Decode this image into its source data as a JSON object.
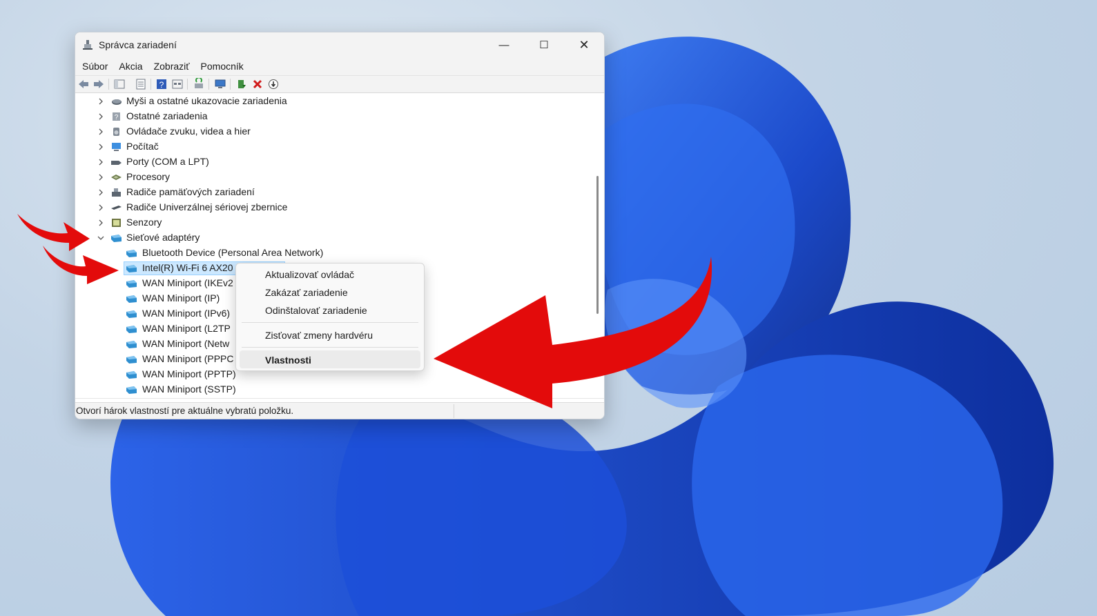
{
  "window": {
    "title": "Správca zariadení",
    "controls": {
      "minimize": "—",
      "maximize": "☐",
      "close": "✕"
    }
  },
  "menu": [
    "Súbor",
    "Akcia",
    "Zobraziť",
    "Pomocník"
  ],
  "toolbar_icons": [
    "back-icon",
    "forward-icon",
    "show-hide-tree-icon",
    "properties-icon",
    "help-icon",
    "view-icon",
    "scan-hardware-icon",
    "monitor-icon",
    "update-driver-icon",
    "uninstall-icon",
    "disable-icon"
  ],
  "tree": {
    "categories": [
      {
        "label": "Myši a ostatné ukazovacie zariadenia",
        "icon": "mouse-icon",
        "expanded": false
      },
      {
        "label": "Ostatné zariadenia",
        "icon": "unknown-device-icon",
        "expanded": false
      },
      {
        "label": "Ovládače zvuku, videa a hier",
        "icon": "speaker-icon",
        "expanded": false
      },
      {
        "label": "Počítač",
        "icon": "computer-icon",
        "expanded": false
      },
      {
        "label": "Porty (COM a LPT)",
        "icon": "port-icon",
        "expanded": false
      },
      {
        "label": "Procesory",
        "icon": "processor-icon",
        "expanded": false
      },
      {
        "label": "Radiče pamäťových zariadení",
        "icon": "storage-controller-icon",
        "expanded": false
      },
      {
        "label": "Radiče Univerzálnej sériovej zbernice",
        "icon": "usb-icon",
        "expanded": false
      },
      {
        "label": "Senzory",
        "icon": "sensor-icon",
        "expanded": false
      },
      {
        "label": "Sieťové adaptéry",
        "icon": "network-adapter-icon",
        "expanded": true
      }
    ],
    "adapters": [
      "Bluetooth Device (Personal Area Network)",
      "Intel(R) Wi-Fi 6 AX20",
      "WAN Miniport (IKEv2",
      "WAN Miniport (IP)",
      "WAN Miniport (IPv6)",
      "WAN Miniport (L2TP",
      "WAN Miniport (Netw",
      "WAN Miniport (PPPC",
      "WAN Miniport (PPTP)",
      "WAN Miniport (SSTP)"
    ],
    "selected_adapter_index": 1
  },
  "context_menu": {
    "items": [
      "Aktualizovať ovládač",
      "Zakázať zariadenie",
      "Odinštalovať zariadenie",
      "Zisťovať zmeny hardvéru",
      "Vlastnosti"
    ],
    "highlighted": "Vlastnosti"
  },
  "status": {
    "text": "Otvorí hárok vlastností pre aktuálne vybratú položku."
  },
  "colors": {
    "arrow": "#e30b0b",
    "selection": "#cce8ff",
    "wallpaper_blue": "#1a4fd6"
  }
}
